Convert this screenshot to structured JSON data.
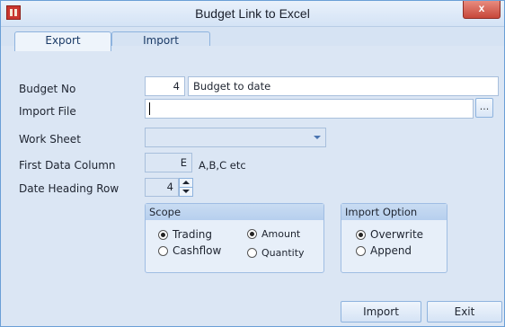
{
  "window": {
    "title": "Budget Link to Excel",
    "close_label": "x"
  },
  "tabs": [
    {
      "label": "Export"
    },
    {
      "label": "Import"
    }
  ],
  "form": {
    "budget_no_label": "Budget No",
    "budget_no_value": "4",
    "budget_name_value": "Budget to date",
    "import_file_label": "Import File",
    "import_file_value": "",
    "browse_label": "...",
    "work_sheet_label": "Work Sheet",
    "work_sheet_value": "",
    "first_data_column_label": "First Data Column",
    "first_data_column_value": "E",
    "first_data_column_hint": "A,B,C etc",
    "date_heading_row_label": "Date Heading Row",
    "date_heading_row_value": "4"
  },
  "scope": {
    "title": "Scope",
    "trading_label": "Trading",
    "cashflow_label": "Cashflow",
    "amount_label": "Amount",
    "quantity_label": "Quantity"
  },
  "import_option": {
    "title": "Import Option",
    "overwrite_label": "Overwrite",
    "append_label": "Append"
  },
  "buttons": {
    "import_label": "Import",
    "exit_label": "Exit"
  }
}
